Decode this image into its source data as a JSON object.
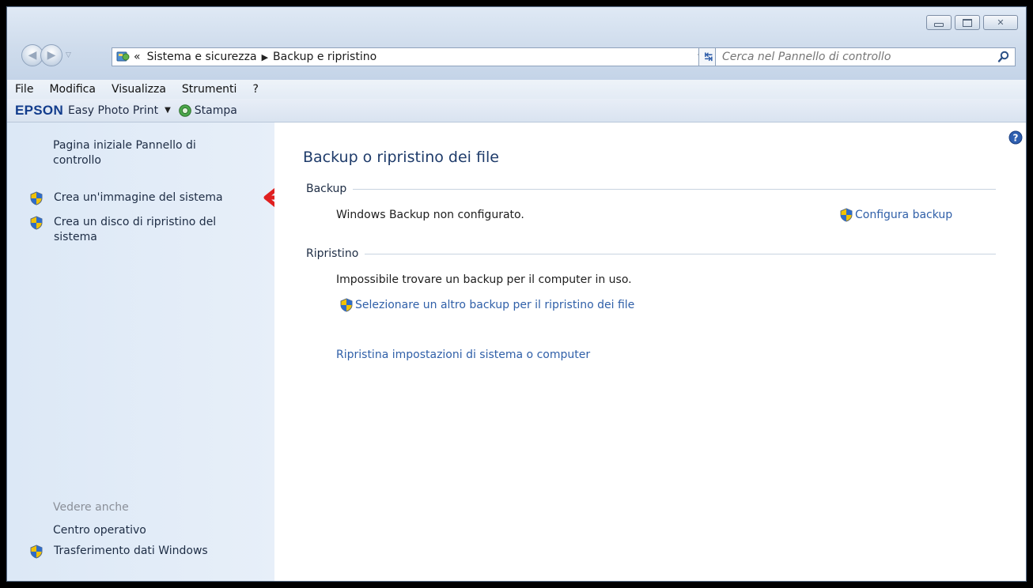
{
  "window": {
    "caption": {
      "minimize": "minimize",
      "maximize": "maximize",
      "close": "close"
    }
  },
  "address": {
    "overflow": "«",
    "crumbs": [
      "Sistema e sicurezza",
      "Backup e ripristino"
    ]
  },
  "search": {
    "placeholder": "Cerca nel Pannello di controllo"
  },
  "menu": [
    "File",
    "Modifica",
    "Visualizza",
    "Strumenti",
    "?"
  ],
  "toolbar": {
    "brand": "EPSON",
    "product": "Easy Photo Print",
    "print_label": "Stampa"
  },
  "sidebar": {
    "home": "Pagina iniziale Pannello di controllo",
    "tasks": [
      "Crea un'immagine del sistema",
      "Crea un disco di ripristino del sistema"
    ],
    "see_also_title": "Vedere anche",
    "see_also": [
      "Centro operativo",
      "Trasferimento dati Windows"
    ]
  },
  "main": {
    "title": "Backup o ripristino dei file",
    "backup": {
      "heading": "Backup",
      "status": "Windows Backup non configurato.",
      "configure_link": "Configura backup"
    },
    "restore": {
      "heading": "Ripristino",
      "status": "Impossibile trovare un backup per il computer in uso.",
      "select_link": "Selezionare un altro backup per il ripristino dei file",
      "system_link": "Ripristina impostazioni di sistema o computer"
    }
  },
  "colors": {
    "link": "#2f5fa8",
    "title": "#1e3b6a",
    "sidebar_bg": "#dce8f6",
    "annotation_arrow": "#e02020"
  }
}
